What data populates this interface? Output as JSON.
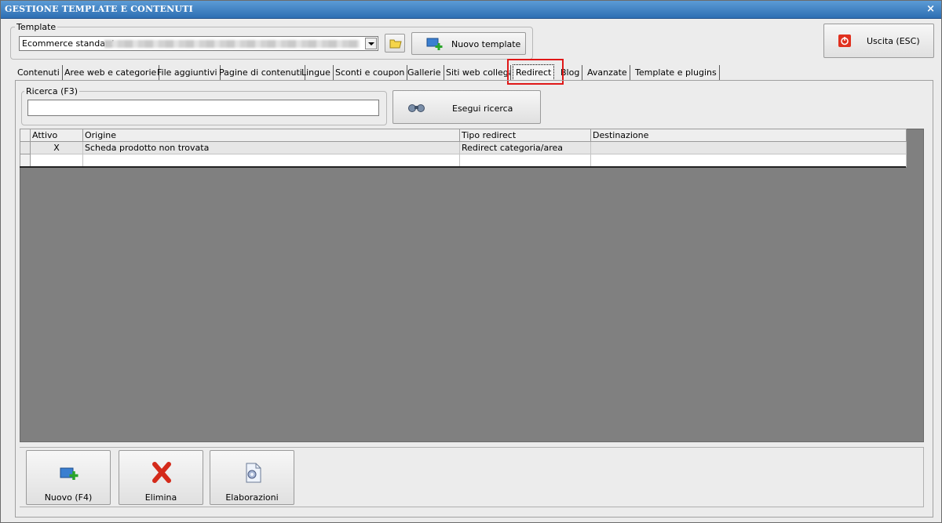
{
  "window": {
    "title": "GESTIONE TEMPLATE E CONTENUTI",
    "close_glyph": "×"
  },
  "template": {
    "group_label": "Template",
    "selected_value": "Ecommerce standard",
    "open_icon": "folder-icon",
    "new_button_label": "Nuovo template"
  },
  "exit_button_label": "Uscita (ESC)",
  "tabs": [
    {
      "label": "Contenuti"
    },
    {
      "label": "Aree web e categorie"
    },
    {
      "label": "File aggiuntivi"
    },
    {
      "label": "Pagine di contenuti"
    },
    {
      "label": "Lingue"
    },
    {
      "label": "Sconti e coupon"
    },
    {
      "label": "Gallerie"
    },
    {
      "label": "Siti web collegati"
    },
    {
      "label": "Redirect"
    },
    {
      "label": "Blog"
    },
    {
      "label": "Avanzate"
    },
    {
      "label": "Template e plugins"
    }
  ],
  "active_tab": "Redirect",
  "search": {
    "group_label": "Ricerca (F3)",
    "value": "",
    "button_label": "Esegui ricerca"
  },
  "table": {
    "columns": [
      "Attivo",
      "Origine",
      "Tipo redirect",
      "Destinazione"
    ],
    "rows": [
      [
        "X",
        "Scheda prodotto non trovata",
        "Redirect categoria/area",
        ""
      ],
      [
        "",
        "",
        "",
        ""
      ]
    ]
  },
  "actions": {
    "new_label": "Nuovo (F4)",
    "delete_label": "Elimina",
    "processing_label": "Elaborazioni"
  },
  "colors": {
    "title_bar": "#2e6fb3",
    "highlight": "#e01818",
    "grid_background": "#808080"
  }
}
